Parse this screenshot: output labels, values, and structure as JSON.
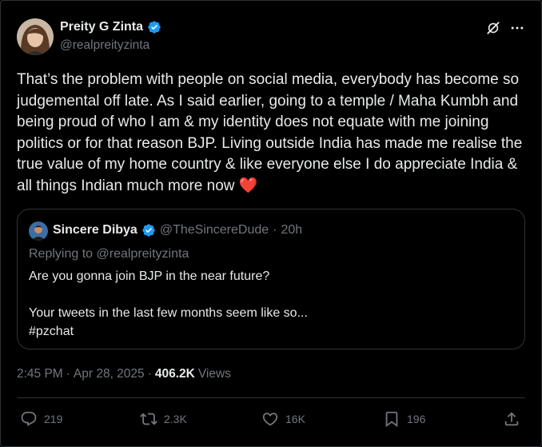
{
  "author": {
    "name": "Preity G Zinta",
    "handle": "@realpreityzinta"
  },
  "tweet": {
    "text": "That’s the problem with people on social media, everybody has become so judgemental off late. As I said earlier, going to a temple / Maha Kumbh and being proud of who I am & my identity does not equate with me joining politics or for that reason BJP. Living outside India has made me realise the true value of my home country  & like everyone else I do appreciate India & all things Indian much more now",
    "heart_emoji": "❤️"
  },
  "quote": {
    "name": "Sincere Dibya",
    "handle": "@TheSincereDude",
    "dot": "·",
    "time": "20h",
    "replying_to": "Replying to @realpreityzinta",
    "body": "Are you gonna join BJP in the near future?\n\nYour tweets in the last few months seem like so...\n#pzchat"
  },
  "meta": {
    "time": "2:45 PM",
    "sep1": "·",
    "date": "Apr 28, 2025",
    "sep2": "·",
    "views_count": "406.2K",
    "views_label": "Views"
  },
  "actions": {
    "replies": "219",
    "reposts": "2.3K",
    "likes": "16K",
    "bookmarks": "196"
  },
  "icons": [
    "verified-badge-icon",
    "grok-icon",
    "more-icon",
    "reply-icon",
    "repost-icon",
    "like-icon",
    "bookmark-icon",
    "share-icon"
  ],
  "colors": {
    "background": "#000000",
    "text": "#e7e9ea",
    "muted": "#71767b",
    "verified": "#1d9bf0",
    "heart": "#e0245e",
    "border": "#2f3336"
  }
}
